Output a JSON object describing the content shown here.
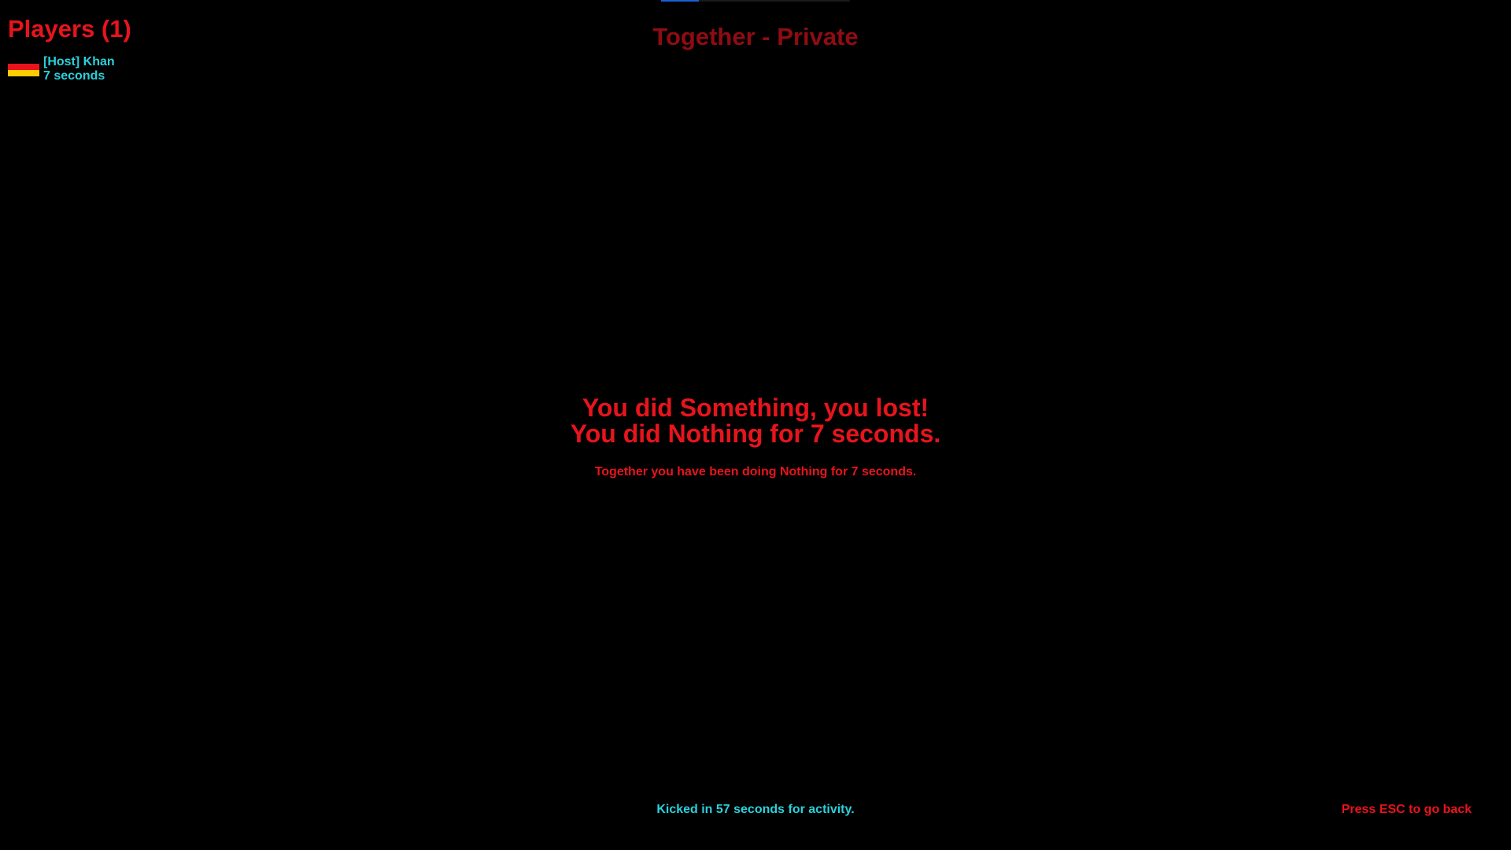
{
  "top_bar": {
    "progress": 0.2,
    "fill_color": "#1e5fd8"
  },
  "players": {
    "title": "Players (1)",
    "list": [
      {
        "name": "[Host] Khan",
        "time": "7 seconds",
        "flag_icon": "germany-flag-icon",
        "flag_colors": [
          "#e8141c",
          "#ffcc00"
        ]
      }
    ]
  },
  "room": {
    "title": "Together - Private"
  },
  "result": {
    "line1": "You did Something, you lost!",
    "line2": "You did Nothing for 7 seconds.",
    "subtitle": "Together you have been doing Nothing for 7 seconds."
  },
  "footer": {
    "kick_notice": "Kicked in 57 seconds for activity.",
    "esc_hint": "Press ESC to go back"
  },
  "colors": {
    "background": "#000000",
    "accent_red": "#e8141c",
    "dark_red": "#8f0c12",
    "cyan": "#2ad1dc"
  }
}
